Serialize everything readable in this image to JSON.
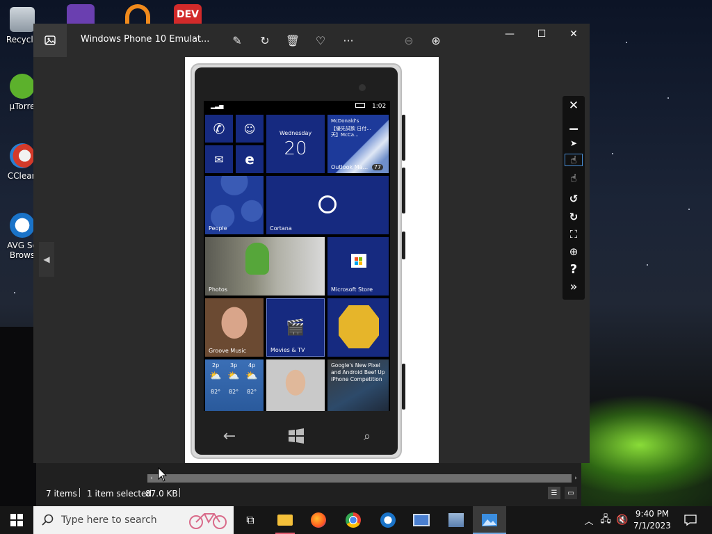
{
  "desktop": {
    "icons": [
      {
        "label": "Recycle"
      },
      {
        "label": "µTorre"
      },
      {
        "label": "CClean"
      },
      {
        "label": "AVG Se Brows"
      }
    ],
    "top_icon_label": "DEV"
  },
  "photos_window": {
    "title": "Windows Phone 10 Emulat...",
    "toolbar_glyphs": {
      "edit": "✎",
      "rotate": "↻",
      "delete": "🗑",
      "favorite": "♡",
      "more": "···",
      "zoom_out": "⊖",
      "zoom_in": "⊕"
    },
    "window_controls": {
      "minimize": "—",
      "maximize": "☐",
      "close": "✕"
    },
    "nav": {
      "prev": "◀",
      "next": "▶"
    }
  },
  "phone": {
    "status": {
      "time": "1:02"
    },
    "tiles": {
      "calendar_day": "Wednesday",
      "calendar_date": "20",
      "mail_sender": "McDonald's",
      "mail_preview": "【優先試飲 日付...天】McCa...",
      "mail_label": "Outlook Ma...",
      "mail_count": "77",
      "people": "People",
      "cortana": "Cortana",
      "photos": "Photos",
      "store": "Microsoft Store",
      "groove": "Groove Music",
      "movies": "Movies & TV",
      "news_headline": "Google's New Pixel and Android Beef Up iPhone Competition"
    },
    "weather": [
      {
        "time": "2p",
        "temp": "82°"
      },
      {
        "time": "3p",
        "temp": "82°"
      },
      {
        "time": "4p",
        "temp": "82°"
      }
    ]
  },
  "emulator_toolbar": {
    "close": "✕",
    "minimize": "▁",
    "pointer": "➤",
    "touch": "☝",
    "multi_touch": "☝",
    "rotate_left": "↺",
    "rotate_right": "↻",
    "fit": "⛶",
    "zoom": "⊕",
    "help": "?",
    "more": "»"
  },
  "explorer": {
    "items_count": "7 items",
    "selected": "1 item selected",
    "size": "87.0 KB"
  },
  "taskbar": {
    "search_placeholder": "Type here to search",
    "clock_time": "9:40 PM",
    "clock_date": "7/1/2023"
  },
  "colors": {
    "tile_blue": "#162a80",
    "taskbar": "#161616",
    "window": "#2b2b2b",
    "accent": "#6fa7e0"
  }
}
